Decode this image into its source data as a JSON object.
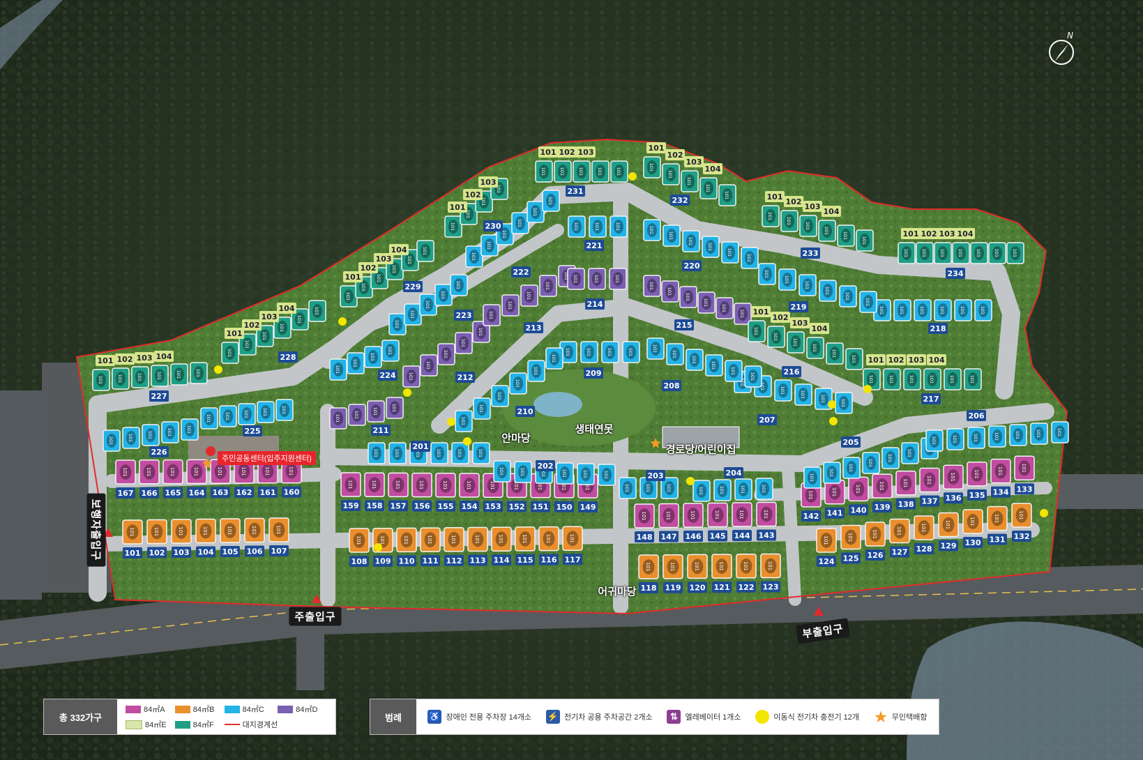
{
  "compass": {
    "label": "N"
  },
  "colors": {
    "84A": "#c04da0",
    "84B": "#e98f2e",
    "84C": "#23b3e6",
    "84D": "#7b5fb1",
    "84E": "#d7e6a9",
    "84F": "#1f9e86",
    "boundary": "#e12b2b",
    "road": "#bfc3c6",
    "forest": "#2a3a27",
    "grass": "#4c7a32",
    "tag": "#1d4b95",
    "tag_green": "#d7e58c",
    "dot": "#f2e500",
    "star": "#f39a27"
  },
  "labels": {
    "main_entrance": "주출입구",
    "sub_entrance": "부출입구",
    "ped_entrance": "보행자출입구",
    "an_madang": "안마당",
    "eco_pond": "생태연못",
    "gyeongrodang": "경로당/어린이집",
    "eogwi_madang": "어귀마당",
    "community_center": "주민공동센터(입주지원센터)"
  },
  "legend_units": {
    "title": "총 332가구",
    "items": [
      {
        "label": "84㎡A",
        "color": "#c04da0"
      },
      {
        "label": "84㎡B",
        "color": "#e98f2e"
      },
      {
        "label": "84㎡C",
        "color": "#23b3e6"
      },
      {
        "label": "84㎡D",
        "color": "#7b5fb1"
      },
      {
        "label": "84㎡E",
        "color": "#d7e6a9"
      },
      {
        "label": "84㎡F",
        "color": "#1f9e86"
      },
      {
        "label": "대지경계선",
        "color": "#e12b2b"
      }
    ]
  },
  "legend_symbols": {
    "title": "범례",
    "items": [
      {
        "icon": "wheelchair-icon",
        "label": "장애인 전용 주차장 14개소"
      },
      {
        "icon": "ev-parking-icon",
        "label": "전기차 공용 주차공간 2개소"
      },
      {
        "icon": "elevator-icon",
        "label": "엘레베이터 1개소"
      },
      {
        "icon": "ev-charger-dot-icon",
        "label": "이동식 전기차 충전기 12개"
      },
      {
        "icon": "parcel-star-icon",
        "label": "무인택배함"
      }
    ]
  },
  "rows": [
    {
      "type": "84B",
      "nums": [
        "101",
        "102",
        "103",
        "104",
        "105",
        "106",
        "107"
      ],
      "unit": "101"
    },
    {
      "type": "84B",
      "nums": [
        "108",
        "109",
        "110",
        "111",
        "112",
        "113",
        "114",
        "115",
        "116",
        "117"
      ],
      "unit": "101"
    },
    {
      "type": "84B",
      "nums": [
        "118",
        "119",
        "120",
        "121",
        "122",
        "123"
      ],
      "unit": "101"
    },
    {
      "type": "84B",
      "nums": [
        "124",
        "125",
        "126",
        "127",
        "128",
        "129",
        "130",
        "131",
        "132"
      ],
      "unit": "101"
    },
    {
      "type": "84A",
      "nums": [
        "167",
        "166",
        "165",
        "164",
        "163",
        "162",
        "161",
        "160"
      ],
      "unit": "101"
    },
    {
      "type": "84A",
      "nums": [
        "159",
        "158",
        "157",
        "156",
        "155",
        "154",
        "153",
        "152",
        "151",
        "150",
        "149"
      ],
      "unit": "101"
    },
    {
      "type": "84A",
      "nums": [
        "148",
        "147",
        "146",
        "145",
        "144",
        "143"
      ],
      "unit": "101"
    },
    {
      "type": "84A",
      "nums": [
        "142",
        "141",
        "140",
        "139",
        "138",
        "137",
        "136",
        "135",
        "134",
        "133"
      ],
      "unit": "101"
    },
    {
      "type": "84C",
      "nums": [
        "201"
      ],
      "unit": "101"
    },
    {
      "type": "84C",
      "nums": [
        "202"
      ],
      "unit": "101"
    },
    {
      "type": "84C",
      "nums": [
        "203"
      ],
      "unit": "101"
    },
    {
      "type": "84C",
      "nums": [
        "204"
      ],
      "unit": "101"
    },
    {
      "type": "84C",
      "nums": [
        "205"
      ],
      "unit": "101"
    },
    {
      "type": "84C",
      "nums": [
        "206"
      ],
      "unit": "101"
    },
    {
      "type": "84C",
      "nums": [
        "207"
      ],
      "unit": "101"
    },
    {
      "type": "84C",
      "nums": [
        "208"
      ],
      "unit": "101"
    },
    {
      "type": "84C",
      "nums": [
        "209"
      ],
      "unit": "101"
    },
    {
      "type": "84C",
      "nums": [
        "210"
      ],
      "unit": "101"
    },
    {
      "type": "84D",
      "nums": [
        "211"
      ],
      "unit": "101"
    },
    {
      "type": "84D",
      "nums": [
        "212"
      ],
      "unit": "101"
    },
    {
      "type": "84D",
      "nums": [
        "213"
      ],
      "unit": "101"
    },
    {
      "type": "84D",
      "nums": [
        "214"
      ],
      "unit": "101"
    },
    {
      "type": "84D",
      "nums": [
        "215"
      ],
      "unit": "101"
    },
    {
      "type": "84F",
      "nums": [
        "216"
      ],
      "unit": "101",
      "houses": [
        "101",
        "102",
        "103",
        "104"
      ]
    },
    {
      "type": "84F",
      "nums": [
        "217"
      ],
      "unit": "101",
      "houses": [
        "101",
        "102",
        "103",
        "104"
      ]
    },
    {
      "type": "84C",
      "nums": [
        "218"
      ],
      "unit": "101"
    },
    {
      "type": "84C",
      "nums": [
        "219"
      ],
      "unit": "101"
    },
    {
      "type": "84C",
      "nums": [
        "220"
      ],
      "unit": "101"
    },
    {
      "type": "84C",
      "nums": [
        "221"
      ],
      "unit": "101"
    },
    {
      "type": "84C",
      "nums": [
        "222"
      ],
      "unit": "101"
    },
    {
      "type": "84C",
      "nums": [
        "223"
      ],
      "unit": "101"
    },
    {
      "type": "84C",
      "nums": [
        "224"
      ],
      "unit": "101"
    },
    {
      "type": "84C",
      "nums": [
        "225"
      ],
      "unit": "101"
    },
    {
      "type": "84C",
      "nums": [
        "226"
      ],
      "unit": "101"
    },
    {
      "type": "84F",
      "nums": [
        "227"
      ],
      "unit": "101",
      "houses": [
        "101",
        "102",
        "103",
        "104"
      ]
    },
    {
      "type": "84F",
      "nums": [
        "228"
      ],
      "unit": "101",
      "houses": [
        "101",
        "102",
        "103",
        "104"
      ]
    },
    {
      "type": "84F",
      "nums": [
        "229"
      ],
      "unit": "101",
      "houses": [
        "101",
        "102",
        "103",
        "104"
      ]
    },
    {
      "type": "84F",
      "nums": [
        "230"
      ],
      "unit": "101",
      "houses": [
        "101",
        "102",
        "103"
      ]
    },
    {
      "type": "84F",
      "nums": [
        "231"
      ],
      "unit": "101",
      "houses": [
        "101",
        "102",
        "103"
      ]
    },
    {
      "type": "84F",
      "nums": [
        "232"
      ],
      "unit": "101",
      "houses": [
        "101",
        "102",
        "103",
        "104"
      ]
    },
    {
      "type": "84F",
      "nums": [
        "233"
      ],
      "unit": "101",
      "houses": [
        "101",
        "102",
        "103",
        "104"
      ]
    },
    {
      "type": "84F",
      "nums": [
        "234"
      ],
      "unit": "101",
      "houses": [
        "101",
        "102",
        "103",
        "104"
      ]
    }
  ]
}
